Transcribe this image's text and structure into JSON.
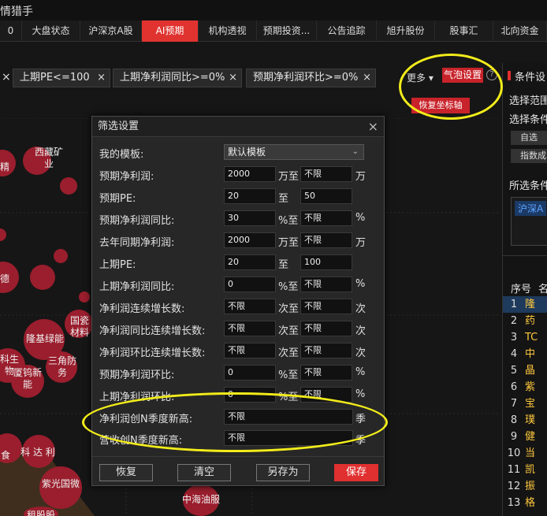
{
  "app": {
    "title": "情猎手"
  },
  "nav": {
    "tabs": [
      {
        "label": "0"
      },
      {
        "label": "大盘状态"
      },
      {
        "label": "沪深京A股"
      },
      {
        "label": "AI预期"
      },
      {
        "label": "机构透视"
      },
      {
        "label": "预期投资..."
      },
      {
        "label": "公告追踪"
      },
      {
        "label": "旭升股份"
      },
      {
        "label": "股事汇"
      },
      {
        "label": "北向资金"
      }
    ],
    "active_index": 3
  },
  "filters": {
    "chips": [
      {
        "label": "上期PE<=100"
      },
      {
        "label": "上期净利润同比>=0%"
      },
      {
        "label": "预期净利润环比>=0%"
      }
    ],
    "first_close": "×",
    "more_label": "更多 ▾",
    "bubble_settings_label": "气泡设置",
    "help_label": "?",
    "reset_axis_label": "恢复坐标轴"
  },
  "chart": {
    "labels": [
      {
        "text": "西藏矿业"
      },
      {
        "text": "精"
      },
      {
        "text": "德"
      },
      {
        "text": "国瓷材料"
      },
      {
        "text": "隆基绿能"
      },
      {
        "text": "科生物"
      },
      {
        "text": "厦钨新能"
      },
      {
        "text": "三角防务"
      },
      {
        "text": "食"
      },
      {
        "text": "科 达 利"
      },
      {
        "text": "紫光国微"
      },
      {
        "text": "中海油服"
      },
      {
        "text": "租股股"
      }
    ]
  },
  "dialog": {
    "title": "筛选设置",
    "close": "×",
    "template_label": "我的模板:",
    "template_value": "默认模板",
    "rows": [
      {
        "label": "预期净利润:",
        "min": "2000",
        "unit1": "万至",
        "max": "不限",
        "unit2": "万"
      },
      {
        "label": "预期PE:",
        "min": "20",
        "unit1": "至",
        "max": "50",
        "unit2": ""
      },
      {
        "label": "预期净利润同比:",
        "min": "30",
        "unit1": "%至",
        "max": "不限",
        "unit2": "%"
      },
      {
        "label": "去年同期净利润:",
        "min": "2000",
        "unit1": "万至",
        "max": "不限",
        "unit2": "万"
      },
      {
        "label": "上期PE:",
        "min": "20",
        "unit1": "至",
        "max": "100",
        "unit2": ""
      },
      {
        "label": "上期净利润同比:",
        "min": "0",
        "unit1": "%至",
        "max": "不限",
        "unit2": "%"
      },
      {
        "label": "净利润连续增长数:",
        "min": "不限",
        "unit1": "次至",
        "max": "不限",
        "unit2": "次"
      },
      {
        "label": "净利润同比连续增长数:",
        "min": "不限",
        "unit1": "次至",
        "max": "不限",
        "unit2": "次"
      },
      {
        "label": "净利润环比连续增长数:",
        "min": "不限",
        "unit1": "次至",
        "max": "不限",
        "unit2": "次"
      },
      {
        "label": "预期净利润环比:",
        "min": "0",
        "unit1": "%至",
        "max": "不限",
        "unit2": "%"
      },
      {
        "label": "上期净利润环比:",
        "min": "0",
        "unit1": "%至",
        "max": "不限",
        "unit2": "%"
      }
    ],
    "wide_rows": [
      {
        "label": "净利润创N季度新高:",
        "value": "不限",
        "unit": "季"
      },
      {
        "label": "营收创N季度新高:",
        "value": "不限",
        "unit": "季"
      }
    ],
    "buttons": {
      "restore": "恢复",
      "clear": "清空",
      "save_as": "另存为",
      "save": "保存"
    }
  },
  "right_panel": {
    "title": "条件设",
    "range_label": "选择范围",
    "cond_label": "选择条件",
    "btn1": "自选",
    "btn2": "指数成",
    "selected_label": "所选条件",
    "tag": "沪深A",
    "col_seq": "序号",
    "col_name": "名",
    "rows": [
      {
        "n": "1",
        "name": "隆"
      },
      {
        "n": "2",
        "name": "药"
      },
      {
        "n": "3",
        "name": "TC"
      },
      {
        "n": "4",
        "name": "中"
      },
      {
        "n": "5",
        "name": "晶"
      },
      {
        "n": "6",
        "name": "紫"
      },
      {
        "n": "7",
        "name": "宝"
      },
      {
        "n": "8",
        "name": "璞"
      },
      {
        "n": "9",
        "name": "健"
      },
      {
        "n": "10",
        "name": "当"
      },
      {
        "n": "11",
        "name": "凯"
      },
      {
        "n": "12",
        "name": "振"
      },
      {
        "n": "13",
        "name": "格"
      }
    ]
  },
  "colors": {
    "accent": "#e0302f",
    "bubble": "#9a1e2d",
    "highlight": "#f2ec1a"
  }
}
